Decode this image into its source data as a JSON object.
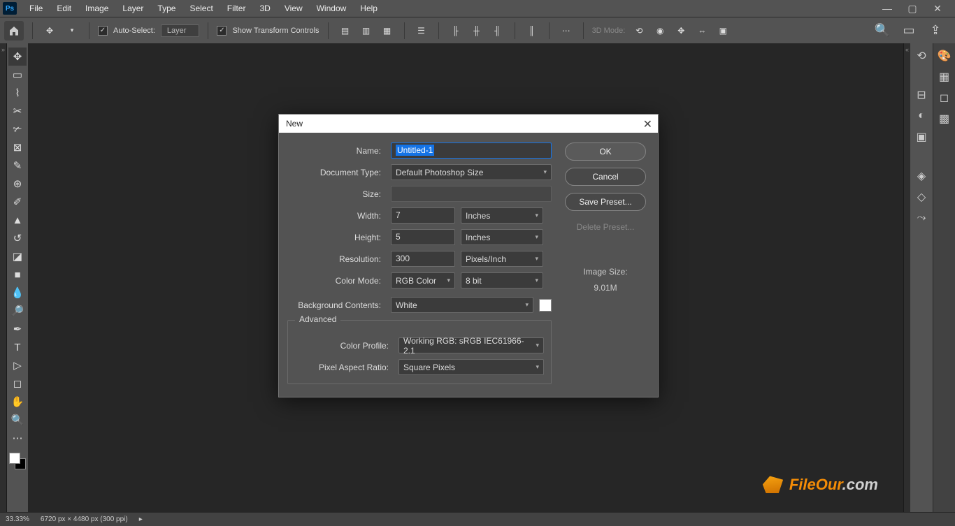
{
  "menubar": {
    "items": [
      "File",
      "Edit",
      "Image",
      "Layer",
      "Type",
      "Select",
      "Filter",
      "3D",
      "View",
      "Window",
      "Help"
    ]
  },
  "optionsbar": {
    "auto_select": "Auto-Select:",
    "layer_dropdown": "Layer",
    "show_transform": "Show Transform Controls",
    "three_d": "3D Mode:"
  },
  "dialog": {
    "title": "New",
    "name_label": "Name:",
    "name_value": "Untitled-1",
    "doc_type_label": "Document Type:",
    "doc_type_value": "Default Photoshop Size",
    "size_label": "Size:",
    "size_value": "",
    "width_label": "Width:",
    "width_value": "7",
    "width_unit": "Inches",
    "height_label": "Height:",
    "height_value": "5",
    "height_unit": "Inches",
    "resolution_label": "Resolution:",
    "resolution_value": "300",
    "resolution_unit": "Pixels/Inch",
    "color_mode_label": "Color Mode:",
    "color_mode_value": "RGB Color",
    "color_depth": "8 bit",
    "bg_label": "Background Contents:",
    "bg_value": "White",
    "advanced": "Advanced",
    "color_profile_label": "Color Profile:",
    "color_profile_value": "Working RGB:  sRGB IEC61966-2.1",
    "aspect_label": "Pixel Aspect Ratio:",
    "aspect_value": "Square Pixels",
    "ok": "OK",
    "cancel": "Cancel",
    "save_preset": "Save Preset...",
    "delete_preset": "Delete Preset...",
    "image_size_label": "Image Size:",
    "image_size_value": "9.01M"
  },
  "statusbar": {
    "zoom": "33.33%",
    "docinfo": "6720 px × 4480 px (300 ppi)"
  },
  "watermark": {
    "text_a": "FileOur",
    "text_b": ".com"
  }
}
